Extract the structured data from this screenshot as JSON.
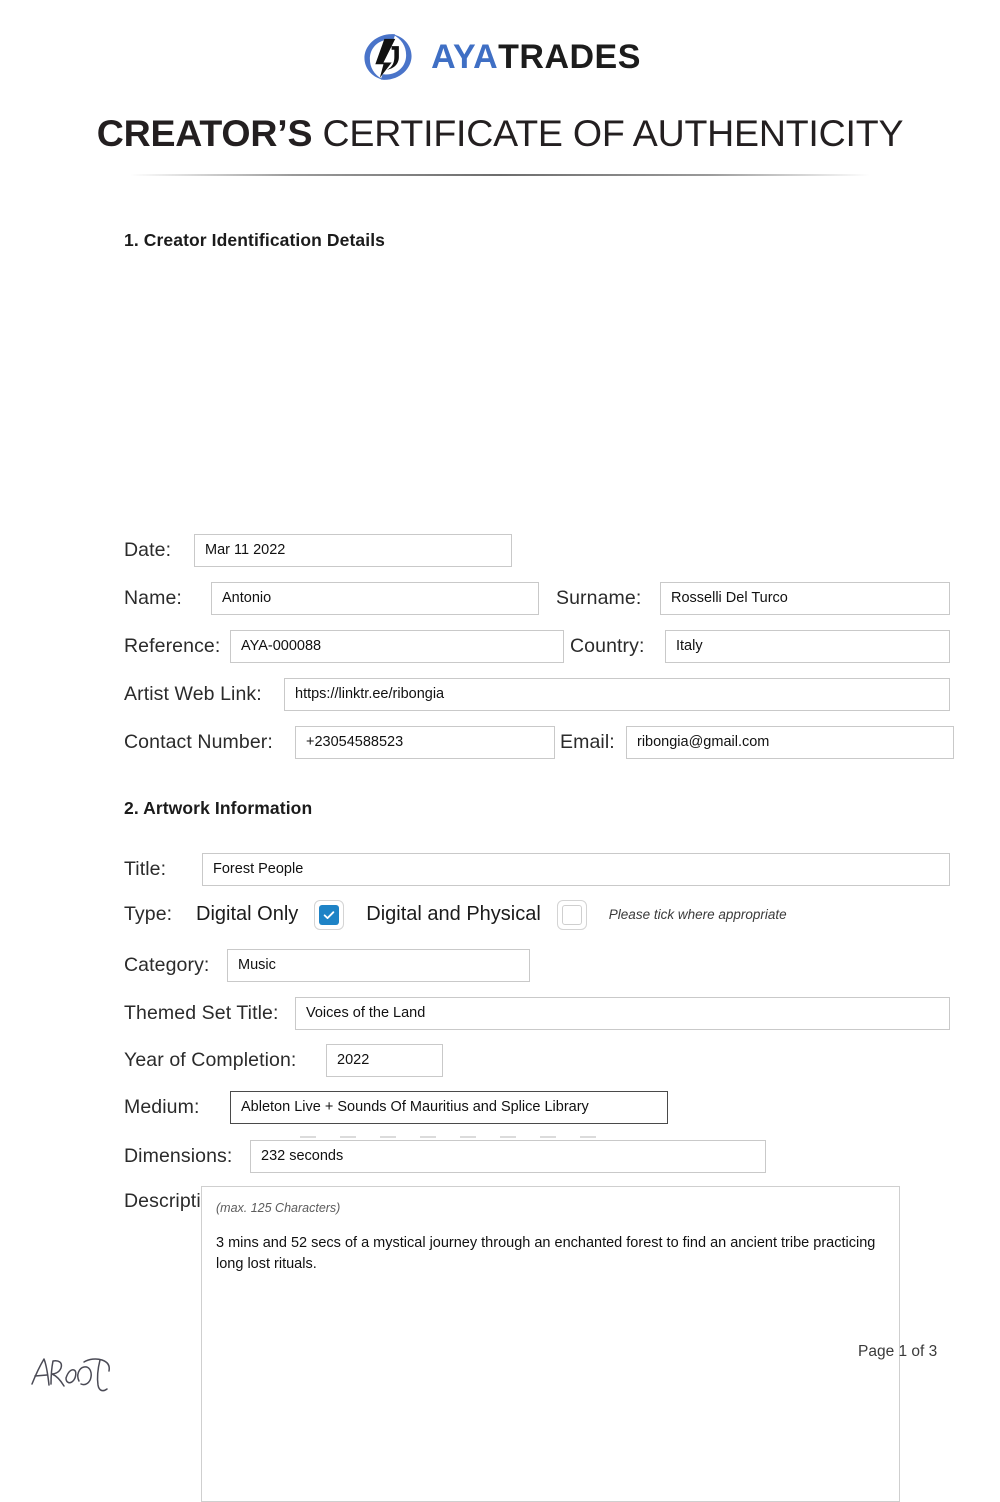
{
  "brand": {
    "name_part1": "AYA",
    "name_part2": "TRADES",
    "logo_icon": "aya-circular-arrow-logo",
    "color_blue": "#3f6fc4",
    "color_dark": "#1c1c1c"
  },
  "document": {
    "title_bold": "CREATOR’S",
    "title_light": "CERTIFICATE OF AUTHENTICITY"
  },
  "section1": {
    "heading": "1. Creator Identification Details",
    "fields": {
      "date_label": "Date:",
      "date_value": "Mar 11 2022",
      "name_label": "Name:",
      "name_value": "Antonio",
      "surname_label": "Surname:",
      "surname_value": "Rosselli Del Turco",
      "reference_label": "Reference:",
      "reference_value": "AYA-000088",
      "country_label": "Country:",
      "country_value": "Italy",
      "weblink_label": "Artist Web Link:",
      "weblink_value": "https://linktr.ee/ribongia",
      "contact_label": "Contact Number:",
      "contact_value": "+23054588523",
      "email_label": "Email:",
      "email_value": "ribongia@gmail.com"
    }
  },
  "section2": {
    "heading": "2. Artwork Information",
    "fields": {
      "title_label": "Title:",
      "title_value": "Forest People",
      "type_label": "Type:",
      "type_option1": "Digital Only",
      "type_option2": "Digital and Physical",
      "type_hint": "Please tick where appropriate",
      "type_option1_checked": true,
      "type_option2_checked": false,
      "category_label": "Category:",
      "category_value": "Music",
      "themed_set_label": "Themed Set Title:",
      "themed_set_value": "Voices of the Land",
      "year_label": "Year of Completion:",
      "year_value": "2022",
      "medium_label": "Medium:",
      "medium_value": "Ableton Live + Sounds Of Mauritius and Splice Library",
      "dimensions_label": "Dimensions:",
      "dimensions_value": "232 seconds",
      "description_label": "Description:",
      "description_placeholder": "(max. 125 Characters)",
      "description_value": "3 mins and 52 secs of a mystical journey through an enchanted forest to find an ancient tribe practicing long lost rituals."
    }
  },
  "footer": {
    "page_number": "Page 1 of 3",
    "signature_icon": "handwritten-signature"
  }
}
